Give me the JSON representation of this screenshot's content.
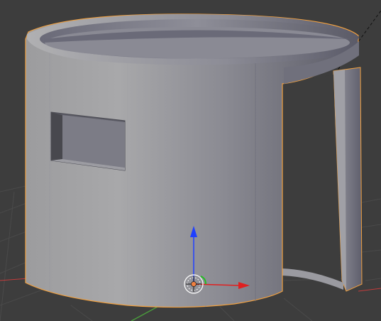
{
  "viewport": {
    "background": "#3d3d3d",
    "grid_color": "#4a4a4a",
    "x_axis_color": "#c33c3c",
    "y_axis_color": "#4a9a3c"
  },
  "object": {
    "selected": true,
    "outline_color": "#f0a040",
    "body_light": "#a4a4a6",
    "body_dark": "#5e5e6a",
    "rim_color": "#7a7a86",
    "cutout_color": "#70707a"
  },
  "manipulator": {
    "icon": "transform-widget-icon",
    "x_color": "#e02020",
    "y_color": "#20c020",
    "z_color": "#2040ff",
    "pivot_color": "#f08040"
  },
  "view": {
    "name": "",
    "projection": ""
  }
}
